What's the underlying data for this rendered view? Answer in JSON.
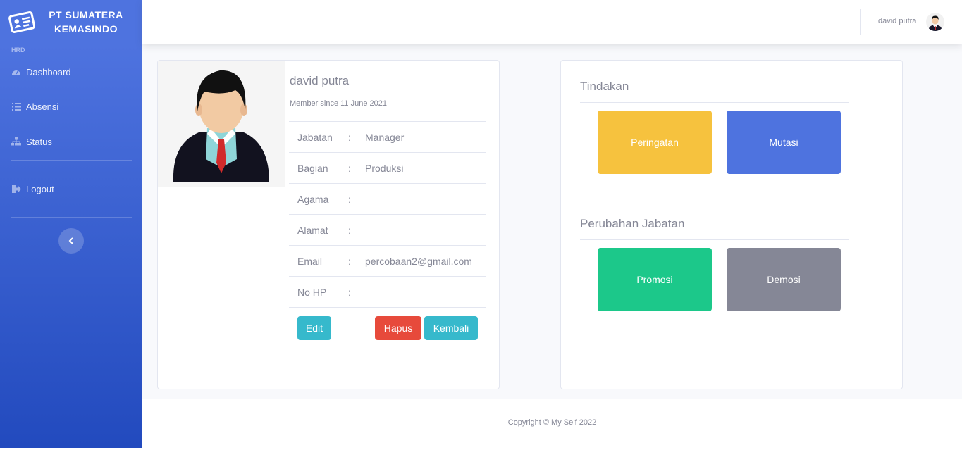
{
  "sidebar": {
    "brand": {
      "line1": "PT SUMATERA",
      "line2": "KEMASINDO"
    },
    "heading": "HRD",
    "items": [
      {
        "label": "Dashboard",
        "icon": "tachometer-icon"
      },
      {
        "label": "Absensi",
        "icon": "list-icon"
      },
      {
        "label": "Status",
        "icon": "sitemap-icon"
      }
    ],
    "logout": {
      "label": "Logout",
      "icon": "sign-out-icon"
    },
    "toggle_icon": "chevron-left-icon"
  },
  "topbar": {
    "username": "david putra"
  },
  "profile": {
    "name": "david putra",
    "member_since": "Member since 11 June 2021",
    "fields": [
      {
        "label": "Jabatan",
        "sep": ":",
        "value": "Manager"
      },
      {
        "label": "Bagian",
        "sep": ":",
        "value": "Produksi"
      },
      {
        "label": "Agama",
        "sep": ":",
        "value": ""
      },
      {
        "label": "Alamat",
        "sep": ":",
        "value": ""
      },
      {
        "label": "Email",
        "sep": ":",
        "value": "percobaan2@gmail.com"
      },
      {
        "label": "No HP",
        "sep": ":",
        "value": ""
      }
    ],
    "buttons": {
      "edit": "Edit",
      "hapus": "Hapus",
      "kembali": "Kembali"
    }
  },
  "actions": {
    "tindakan": {
      "title": "Tindakan",
      "peringatan": "Peringatan",
      "mutasi": "Mutasi"
    },
    "perubahan": {
      "title": "Perubahan Jabatan",
      "promosi": "Promosi",
      "demosi": "Demosi"
    }
  },
  "colors": {
    "primary": "#4e73df",
    "warning": "#f6c23e",
    "success": "#1cc88a",
    "danger": "#e74a3b",
    "info": "#36b9cc",
    "secondary": "#858796"
  },
  "footer": {
    "copyright": "Copyright © My Self 2022"
  }
}
